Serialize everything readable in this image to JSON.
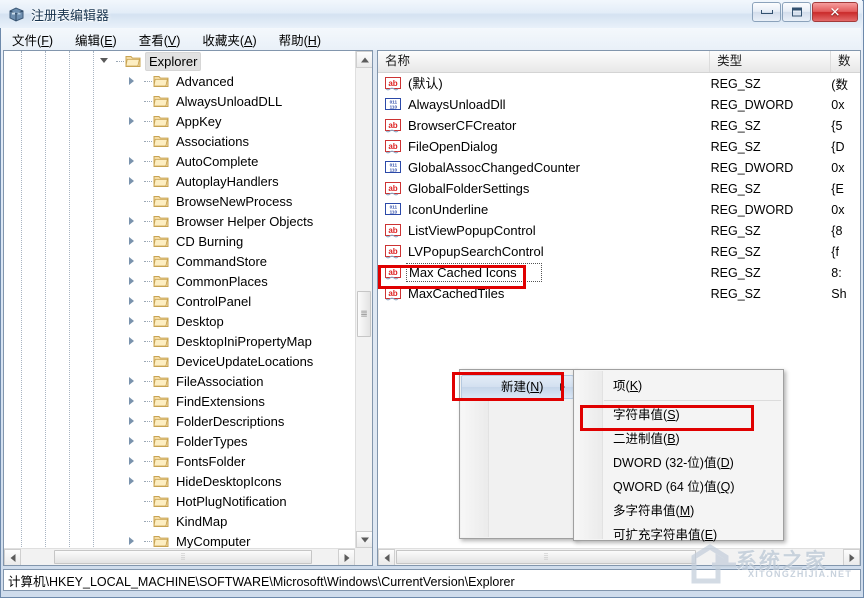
{
  "window": {
    "title": "注册表编辑器",
    "icon": "registry-editor-icon",
    "buttons": {
      "minimize": "最小化",
      "maximize": "最大化",
      "close": "✕"
    }
  },
  "menubar": [
    {
      "label": "文件(F)",
      "text": "文件",
      "key": "F"
    },
    {
      "label": "编辑(E)",
      "text": "编辑",
      "key": "E"
    },
    {
      "label": "查看(V)",
      "text": "查看",
      "key": "V"
    },
    {
      "label": "收藏夹(A)",
      "text": "收藏夹",
      "key": "A"
    },
    {
      "label": "帮助(H)",
      "text": "帮助",
      "key": "H"
    }
  ],
  "tree": {
    "selected": "Explorer",
    "nodes": [
      {
        "label": "Explorer",
        "indent": 0,
        "expander": "open",
        "selected": true
      },
      {
        "label": "Advanced",
        "indent": 1,
        "expander": "closed"
      },
      {
        "label": "AlwaysUnloadDLL",
        "indent": 1,
        "expander": "none"
      },
      {
        "label": "AppKey",
        "indent": 1,
        "expander": "closed"
      },
      {
        "label": "Associations",
        "indent": 1,
        "expander": "none"
      },
      {
        "label": "AutoComplete",
        "indent": 1,
        "expander": "closed"
      },
      {
        "label": "AutoplayHandlers",
        "indent": 1,
        "expander": "closed"
      },
      {
        "label": "BrowseNewProcess",
        "indent": 1,
        "expander": "none"
      },
      {
        "label": "Browser Helper Objects",
        "indent": 1,
        "expander": "closed"
      },
      {
        "label": "CD Burning",
        "indent": 1,
        "expander": "closed"
      },
      {
        "label": "CommandStore",
        "indent": 1,
        "expander": "closed"
      },
      {
        "label": "CommonPlaces",
        "indent": 1,
        "expander": "closed"
      },
      {
        "label": "ControlPanel",
        "indent": 1,
        "expander": "closed"
      },
      {
        "label": "Desktop",
        "indent": 1,
        "expander": "closed"
      },
      {
        "label": "DesktopIniPropertyMap",
        "indent": 1,
        "expander": "closed"
      },
      {
        "label": "DeviceUpdateLocations",
        "indent": 1,
        "expander": "none"
      },
      {
        "label": "FileAssociation",
        "indent": 1,
        "expander": "closed"
      },
      {
        "label": "FindExtensions",
        "indent": 1,
        "expander": "closed"
      },
      {
        "label": "FolderDescriptions",
        "indent": 1,
        "expander": "closed"
      },
      {
        "label": "FolderTypes",
        "indent": 1,
        "expander": "closed"
      },
      {
        "label": "FontsFolder",
        "indent": 1,
        "expander": "closed"
      },
      {
        "label": "HideDesktopIcons",
        "indent": 1,
        "expander": "closed"
      },
      {
        "label": "HotPlugNotification",
        "indent": 1,
        "expander": "none"
      },
      {
        "label": "KindMap",
        "indent": 1,
        "expander": "none"
      },
      {
        "label": "MyComputer",
        "indent": 1,
        "expander": "closed"
      }
    ]
  },
  "list": {
    "columns": [
      {
        "label": "名称"
      },
      {
        "label": "类型"
      },
      {
        "label": "数"
      }
    ],
    "rows": [
      {
        "name": "(默认)",
        "icon": "string-value-icon",
        "type": "REG_SZ",
        "data": "(数"
      },
      {
        "name": "AlwaysUnloadDll",
        "icon": "dword-value-icon",
        "type": "REG_DWORD",
        "data": "0x"
      },
      {
        "name": "BrowserCFCreator",
        "icon": "string-value-icon",
        "type": "REG_SZ",
        "data": "{5"
      },
      {
        "name": "FileOpenDialog",
        "icon": "string-value-icon",
        "type": "REG_SZ",
        "data": "{D"
      },
      {
        "name": "GlobalAssocChangedCounter",
        "icon": "dword-value-icon",
        "type": "REG_DWORD",
        "data": "0x"
      },
      {
        "name": "GlobalFolderSettings",
        "icon": "string-value-icon",
        "type": "REG_SZ",
        "data": "{E"
      },
      {
        "name": "IconUnderline",
        "icon": "dword-value-icon",
        "type": "REG_DWORD",
        "data": "0x"
      },
      {
        "name": "ListViewPopupControl",
        "icon": "string-value-icon",
        "type": "REG_SZ",
        "data": "{8"
      },
      {
        "name": "LVPopupSearchControl",
        "icon": "string-value-icon",
        "type": "REG_SZ",
        "data": "{f"
      },
      {
        "name": "Max Cached Icons",
        "icon": "string-value-icon",
        "type": "REG_SZ",
        "data": "8:",
        "focused": true,
        "highlighted": true
      },
      {
        "name": "MaxCachedTiles",
        "icon": "string-value-icon",
        "type": "REG_SZ",
        "data": "Sh"
      }
    ]
  },
  "context_menu": {
    "main": [
      {
        "label": "新建(N)",
        "text": "新建",
        "key": "N",
        "hover": true,
        "submenu": true,
        "highlighted": true
      }
    ],
    "submenu": [
      {
        "label": "项(K)",
        "text": "项",
        "key": "K"
      },
      {
        "label": "字符串值(S)",
        "text": "字符串值",
        "key": "S",
        "highlighted": true
      },
      {
        "label": "二进制值(B)",
        "text": "二进制值",
        "key": "B"
      },
      {
        "label": "DWORD (32-位)值(D)",
        "text": "DWORD (32-位)值",
        "key": "D"
      },
      {
        "label": "QWORD (64 位)值(Q)",
        "text": "QWORD (64 位)值",
        "key": "Q"
      },
      {
        "label": "多字符串值(M)",
        "text": "多字符串值",
        "key": "M"
      },
      {
        "label": "可扩充字符串值(E)",
        "text": "可扩充字符串值",
        "key": "E"
      }
    ]
  },
  "statusbar": {
    "path": "计算机\\HKEY_LOCAL_MACHINE\\SOFTWARE\\Microsoft\\Windows\\CurrentVersion\\Explorer"
  },
  "watermark": {
    "text": "系统之家",
    "subtext": "XITONGZHIJIA.NET"
  },
  "colors": {
    "annotation": "#e00000",
    "title_text": "#17334e",
    "close_button": "#ca2a2a",
    "selection": "#e2e2e2"
  }
}
